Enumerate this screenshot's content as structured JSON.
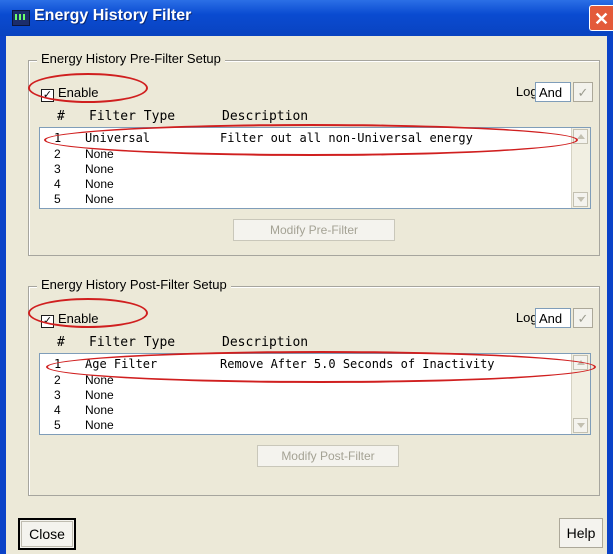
{
  "window": {
    "title": "Energy History Filter"
  },
  "pre": {
    "legend": "Energy History Pre-Filter Setup",
    "enable_label": "Enable",
    "enable_checked": true,
    "logic_label": "Logic",
    "logic_value": "And",
    "headers": {
      "num": "#",
      "type": "Filter Type",
      "desc": "Description"
    },
    "rows": [
      {
        "num": "1",
        "type": "Universal",
        "desc": "Filter out all non-Universal energy"
      },
      {
        "num": "2",
        "type": "None",
        "desc": ""
      },
      {
        "num": "3",
        "type": "None",
        "desc": ""
      },
      {
        "num": "4",
        "type": "None",
        "desc": ""
      },
      {
        "num": "5",
        "type": "None",
        "desc": ""
      }
    ],
    "modify_label": "Modify Pre-Filter"
  },
  "post": {
    "legend": "Energy History Post-Filter Setup",
    "enable_label": "Enable",
    "enable_checked": true,
    "logic_label": "Logic",
    "logic_value": "And",
    "headers": {
      "num": "#",
      "type": "Filter Type",
      "desc": "Description"
    },
    "rows": [
      {
        "num": "1",
        "type": "Age Filter",
        "desc": "Remove After 5.0 Seconds of Inactivity"
      },
      {
        "num": "2",
        "type": "None",
        "desc": ""
      },
      {
        "num": "3",
        "type": "None",
        "desc": ""
      },
      {
        "num": "4",
        "type": "None",
        "desc": ""
      },
      {
        "num": "5",
        "type": "None",
        "desc": ""
      }
    ],
    "modify_label": "Modify Post-Filter"
  },
  "footer": {
    "close_label": "Close",
    "help_label": "Help"
  },
  "colors": {
    "title_bar": "#0a4bd1",
    "highlight_oval": "#d01f1f",
    "dialog_bg": "#ece9d8"
  }
}
